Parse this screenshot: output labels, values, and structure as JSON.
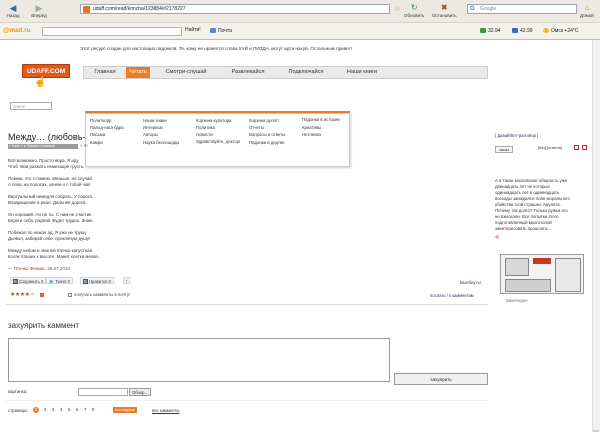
{
  "browser": {
    "back": "Назад",
    "forward": "Вперед",
    "url": "udaff.com/read/koncha/123884/#2178227",
    "reload": "Обновить",
    "stop": "Остановить",
    "home": "Домой",
    "search_placeholder": "Google",
    "search_engine_icon": "G"
  },
  "mailbar": {
    "brand": "@mail.ru",
    "find": "Найти!",
    "mail": "Почта",
    "currency1": "32.94",
    "currency2": "42.99",
    "weather": "Омск +24°C"
  },
  "notice": "Этот ресурс создан для настоящих падонков. Те, кому не нравятся слова ХУЙ и ПИЗДА, могут идти нахуй. Остальным привет!",
  "site": {
    "logo": "UDAFF.COM",
    "nav": [
      "Главная",
      "Читать",
      "Смотри-слушай",
      "Развлекайся",
      "Подключайся",
      "Наши книги"
    ],
    "search_placeholder": "поиск"
  },
  "dropdown": {
    "col1": [
      "Политкорр",
      "Палод-нага бдра",
      "Письма",
      "Камри"
    ],
    "col2": [
      "Наши знаки",
      "Интервью",
      "Авторы",
      "Наука беспощады"
    ],
    "col3": [
      "Корзина куратора",
      "Политика",
      "Новости",
      "Здравствуйте, доктор!"
    ],
    "col4": [
      "Корзина рулят!",
      "Отчеты",
      "Вопросы и ответы",
      "Падонки в дедтве"
    ],
    "col5": [
      "Падонки в истории",
      "Креативы",
      "Нетленка"
    ]
  },
  "article": {
    "title": "Между… (любовь-",
    "tagline": "« Satin » ● Пишем и учиться",
    "poem": [
      "Всё возможно. Просто вера. Я иду",
      "Чтоб твои разжать немеющие грусть.",
      "",
      "Помню, что с-помню. Меньше, но случай.",
      "А пока, на полосах, зачем-о с тобой чай.",
      "",
      "Виртуальный немедля собрать. У порога.",
      "Возвращение в реал. Дальняя дорога.",
      "",
      "Он хороший. Но не ты. С ним не счастие.",
      "Береги себя, родной. Будет трудно. Знаю.",
      "",
      "Побежал по нежая ад. Я уже не трушу",
      "Дьявол, забирай себе, прокляную душу!",
      "",
      "Между небом и землей птичка капустная",
      "Косяк пташек к высоте. Манит клетка мехая.."
    ],
    "author_prefix": "—",
    "author": "Птичко Феникс",
    "date": ", 26.07.2013",
    "complain": "Выебнуть!",
    "notify": "получать камменты в почту!",
    "bottom_links": "послать / к камментам"
  },
  "share": {
    "vk": "Сохранить",
    "vk_count": "0",
    "twitter": "Tweet",
    "twitter_count": "0",
    "like": "Нравится",
    "like_count": "0"
  },
  "rating": {
    "filled_stars": 4,
    "total_stars": 5
  },
  "comment": {
    "title": "захуярить каммент",
    "submit": "захуярить",
    "pic_label": "картинка:",
    "browse": "Обзор..."
  },
  "pager": {
    "label": "страница:",
    "current": "1",
    "pages": [
      "2",
      "3",
      "4",
      "5",
      "6",
      "7",
      "8"
    ],
    "next": "последняя",
    "all": "все камменты"
  },
  "sidebar": {
    "link": "[ Давай/Вот-разговор ]",
    "button": "заказ",
    "links": "[без] [отмена]",
    "quote": [
      "А в такое московское общность уже",
      "двенадцать лет не которые",
      "одиннадцать лет в одиннадцать",
      "восходы заиждался план морального",
      "убийства этой страшно Амулета.",
      "Почему так долго? Только ружья его",
      "не взыскали. Все попытки этого",
      "подготовленный многотолой",
      "заинтересовать прошлого..."
    ],
    "quote_mark": "«",
    "wiki": "Википедия"
  },
  "colors": {
    "accent": "#ef7a2a",
    "logo": "#e05a1c",
    "link": "#335"
  }
}
